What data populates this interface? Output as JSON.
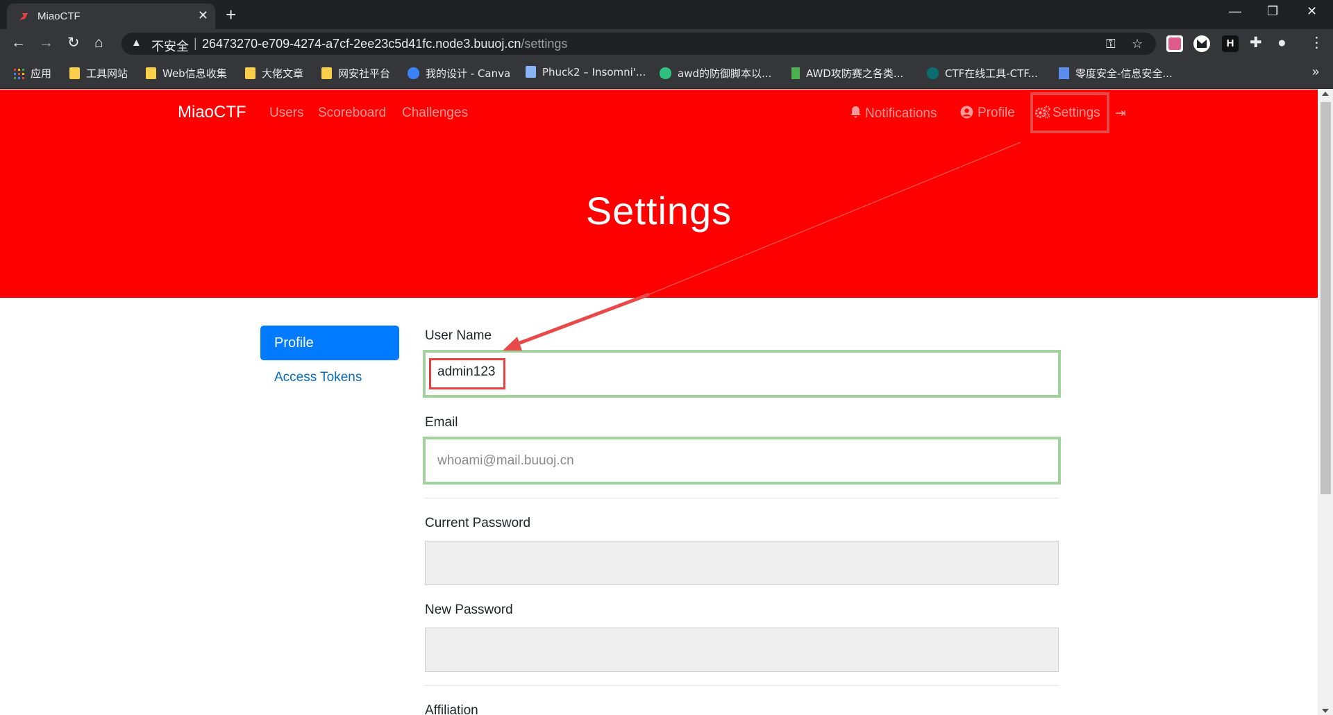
{
  "browser": {
    "tab_title": "MiaoCTF",
    "tab_close": "✕",
    "new_tab": "+",
    "window_controls": {
      "minimize": "—",
      "restore": "❐",
      "close": "✕"
    },
    "nav": {
      "back": "←",
      "forward": "→",
      "reload": "↻",
      "home": "⌂"
    },
    "omnibox": {
      "warning": "▲",
      "security_label": "不安全",
      "separator": "|",
      "url_host": "26473270-e709-4274-a7cf-2ee23c5d41fc.node3.buuoj.cn",
      "url_path": "/settings"
    },
    "omnibox_icons": {
      "key": "⚿",
      "star": "☆"
    },
    "extensions_icon": "✚",
    "profile_icon": "●",
    "menu_icon": "⋮",
    "bookmarks": [
      {
        "label": "应用",
        "icon": "apps-grid-icon"
      },
      {
        "label": "工具网站",
        "icon": "folder-icon"
      },
      {
        "label": "Web信息收集",
        "icon": "folder-icon"
      },
      {
        "label": "大佬文章",
        "icon": "folder-icon"
      },
      {
        "label": "网安社平台",
        "icon": "folder-icon"
      },
      {
        "label": "我的设计 - Canva",
        "icon": "canva-icon"
      },
      {
        "label": "Phuck2 – Insomni'...",
        "icon": "page-icon"
      },
      {
        "label": "awd的防御脚本以...",
        "icon": "n-icon"
      },
      {
        "label": "AWD攻防赛之各类...",
        "icon": "bars-icon"
      },
      {
        "label": "CTF在线工具-CTF...",
        "icon": "ctf-icon"
      },
      {
        "label": "零度安全-信息安全...",
        "icon": "zero-icon"
      }
    ],
    "bookmarks_more": "»"
  },
  "site": {
    "brand": "MiaoCTF",
    "nav_left": [
      "Users",
      "Scoreboard",
      "Challenges"
    ],
    "nav_right": {
      "notifications": "Notifications",
      "profile": "Profile",
      "settings": "Settings",
      "logout_icon": "⇥"
    },
    "hero_title": "Settings",
    "colors": {
      "hero": "#ff0000",
      "primary": "#007bff",
      "highlight_red": "#e84a4a",
      "highlight_green": "#a3d39c"
    }
  },
  "sidebar": {
    "items": [
      {
        "label": "Profile",
        "active": true
      },
      {
        "label": "Access Tokens",
        "active": false
      }
    ]
  },
  "form": {
    "username": {
      "label": "User Name",
      "value": "admin123"
    },
    "email": {
      "label": "Email",
      "placeholder": "whoami@mail.buuoj.cn"
    },
    "current_password": {
      "label": "Current Password",
      "value": ""
    },
    "new_password": {
      "label": "New Password",
      "value": ""
    },
    "affiliation": {
      "label": "Affiliation"
    }
  }
}
